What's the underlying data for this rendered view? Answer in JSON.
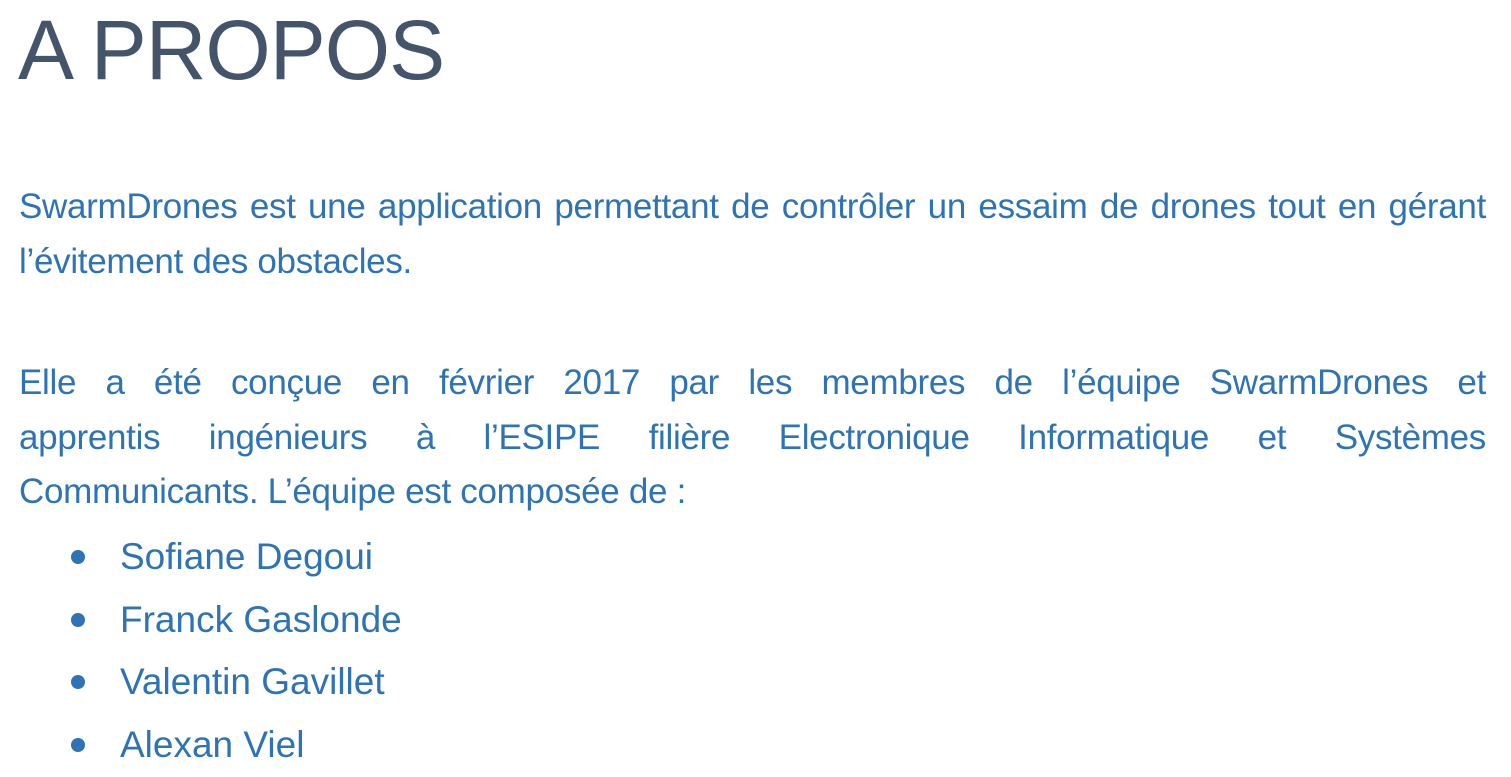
{
  "document": {
    "title": "A PROPOS",
    "paragraph1": "SwarmDrones est une application permettant de contrôler un essaim de drones tout en gérant l’évitement des obstacles.",
    "paragraph2_lines": [
      "Elle a été conçue en février 2017 par les membres de l’équipe SwarmDrones et",
      "apprentis ingénieurs à l’ESIPE filière Electronique Informatique et Systèmes",
      "Communicants. L’équipe est composée de :"
    ],
    "members": [
      "Sofiane Degoui",
      "Franck Gaslonde",
      "Valentin Gavillet",
      "Alexan Viel"
    ]
  },
  "colors": {
    "title": "#44546a",
    "body": "#2e74b5"
  }
}
